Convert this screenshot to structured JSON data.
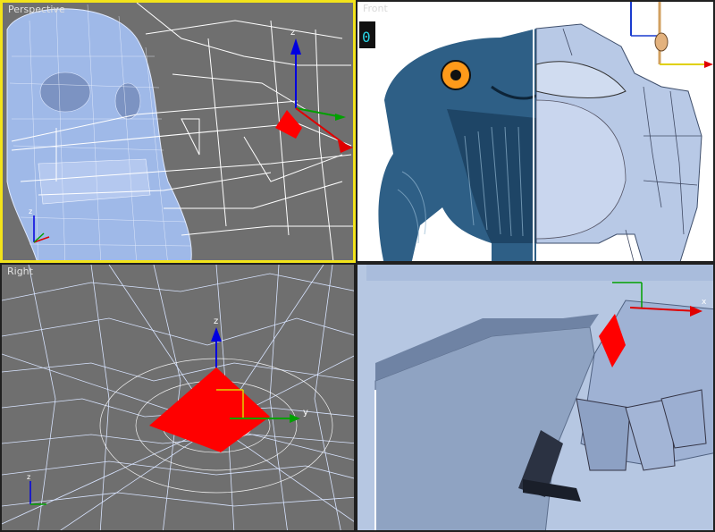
{
  "viewports": {
    "perspective": {
      "label": "Perspective",
      "active": true
    },
    "front": {
      "label": "Front",
      "overlay_text": "0"
    },
    "right": {
      "label": "Right"
    }
  },
  "axis": {
    "x": "x",
    "y": "y",
    "z": "z"
  },
  "colors": {
    "active_border": "#f2e31a",
    "viewport_bg": "#6f6f6f",
    "mesh_blue": "#9fb9e8",
    "wire": "#ffffff",
    "selection_red": "#ff0000",
    "gizmo_x": "#e00000",
    "gizmo_y": "#00a000",
    "gizmo_z": "#0000e0"
  }
}
